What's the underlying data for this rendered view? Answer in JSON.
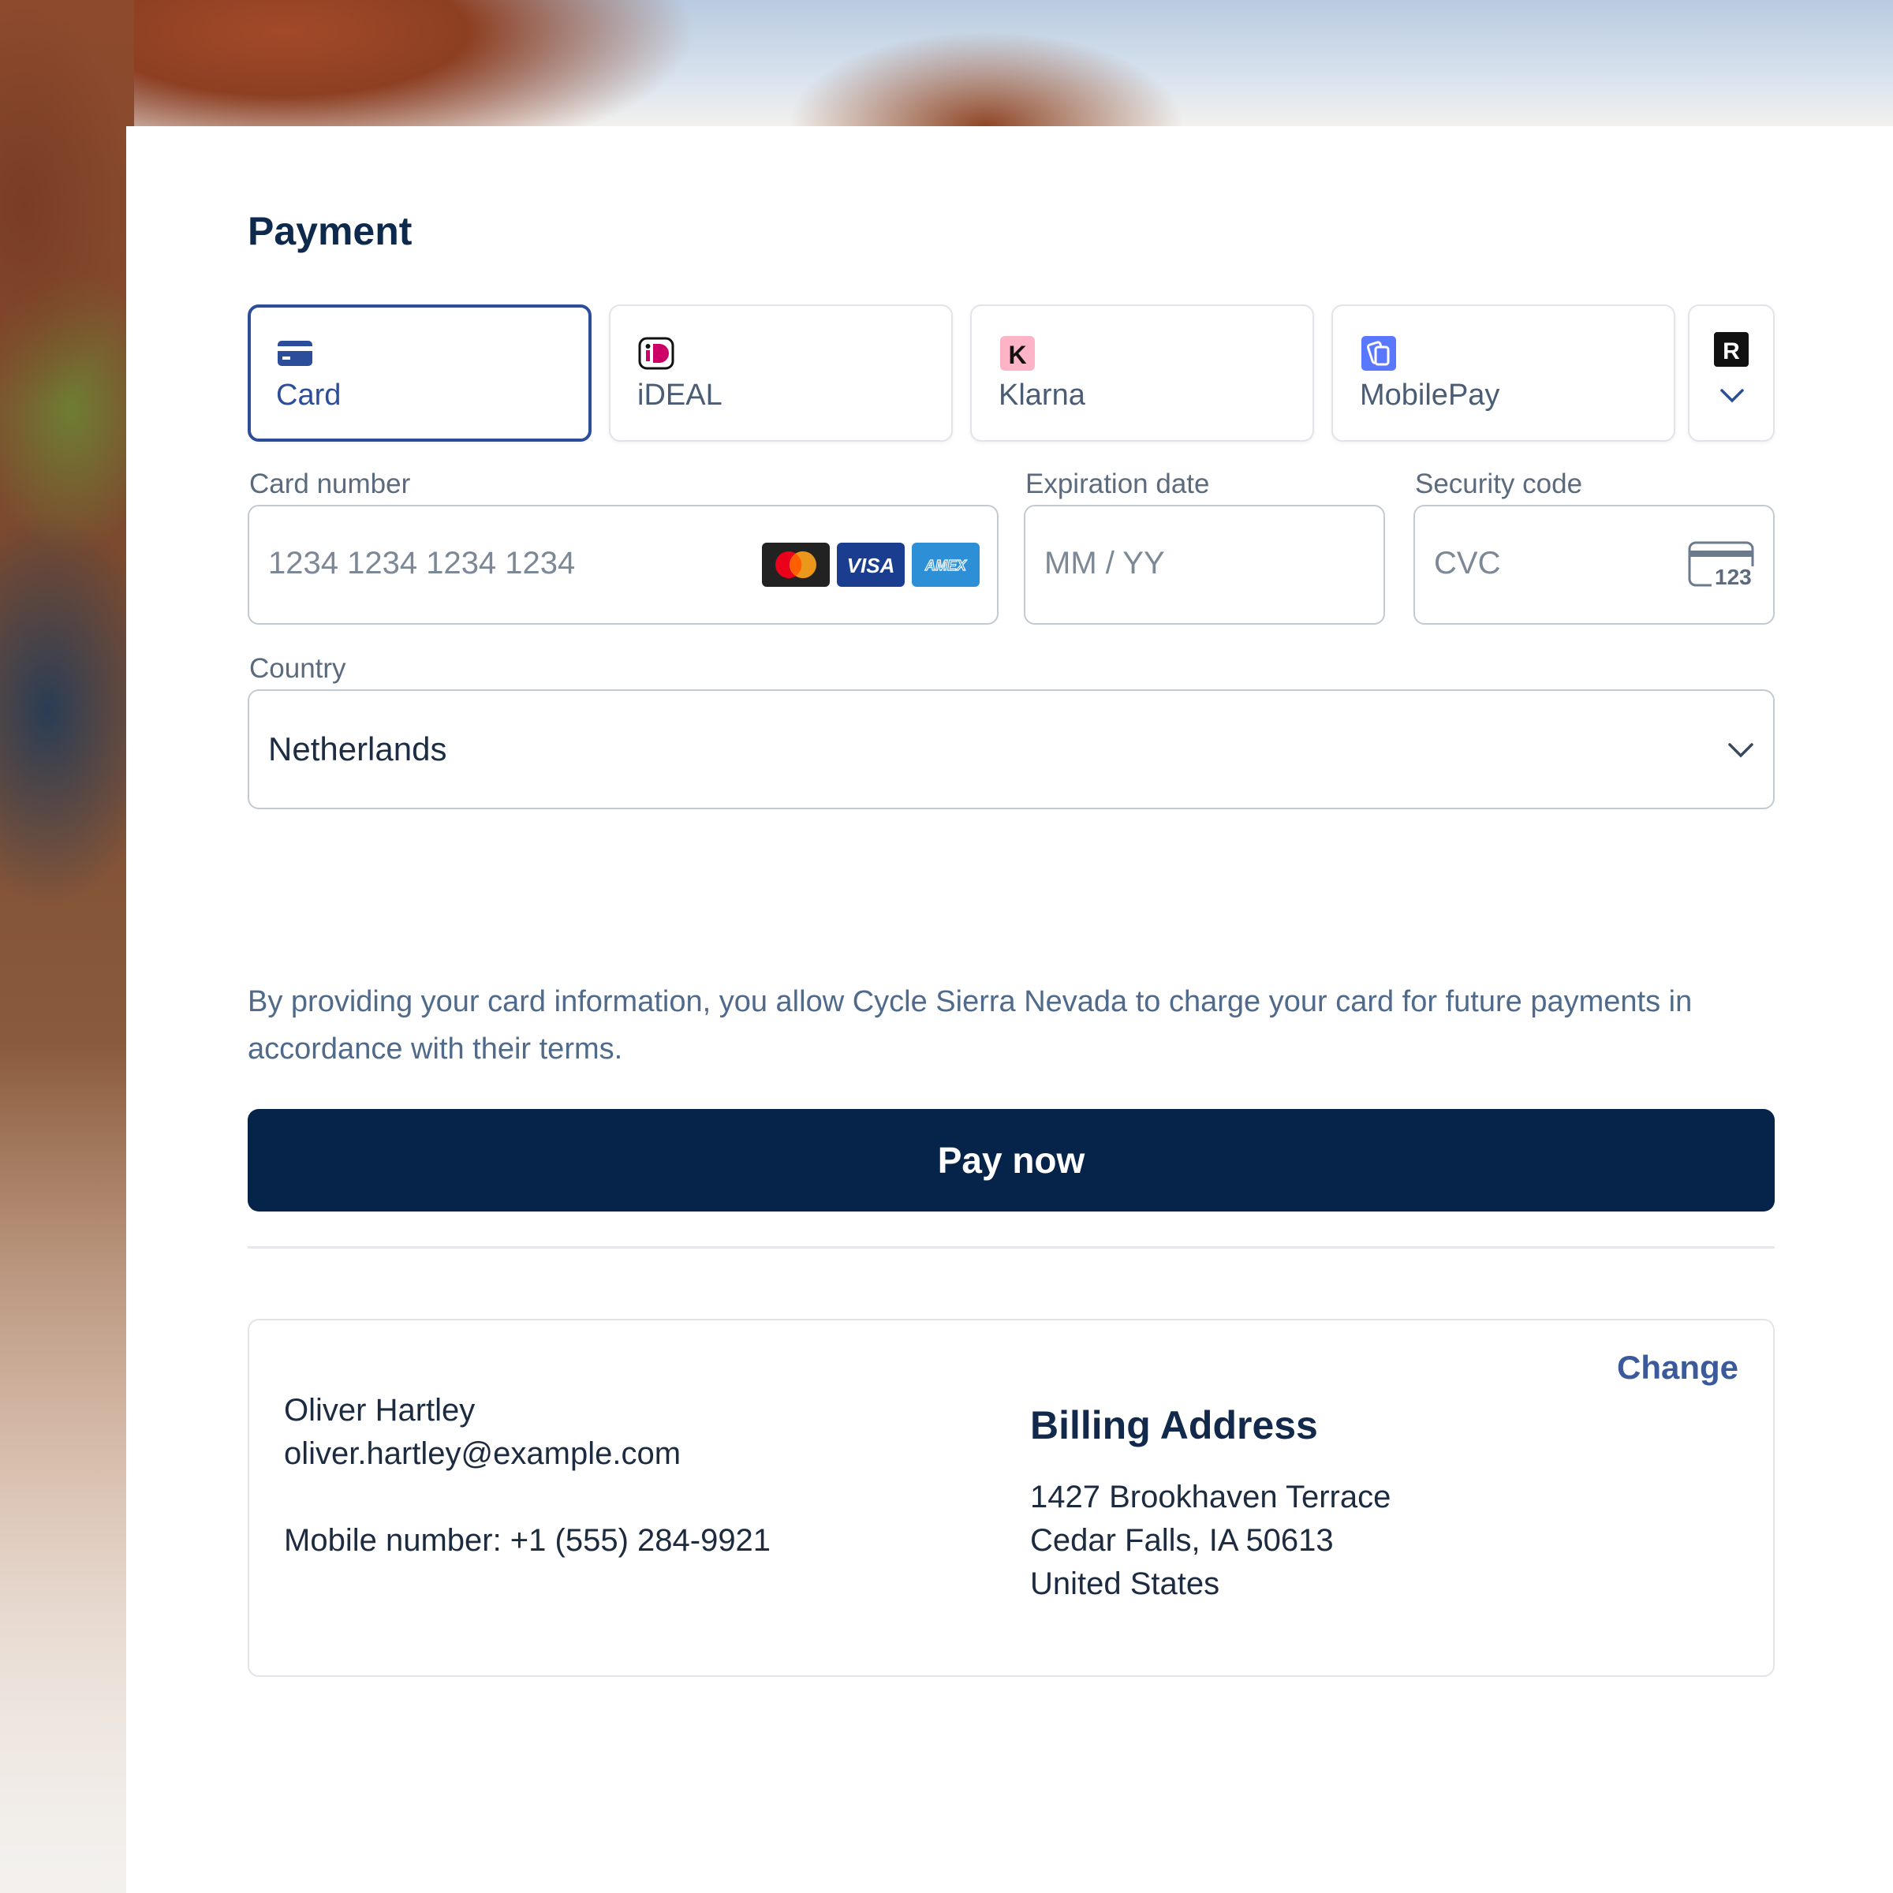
{
  "title": "Payment",
  "methods": [
    {
      "label": "Card",
      "icon": "card-icon",
      "active": true
    },
    {
      "label": "iDEAL",
      "icon": "ideal-icon",
      "active": false
    },
    {
      "label": "Klarna",
      "icon": "klarna-icon",
      "active": false
    },
    {
      "label": "MobilePay",
      "icon": "mobilepay-icon",
      "active": false
    }
  ],
  "more_method_icon": "revolut-icon",
  "card_number": {
    "label": "Card number",
    "placeholder": "1234 1234 1234 1234",
    "brands": [
      "mastercard",
      "visa",
      "amex"
    ]
  },
  "expiry": {
    "label": "Expiration date",
    "placeholder": "MM / YY"
  },
  "cvc": {
    "label": "Security code",
    "placeholder": "CVC",
    "icon_text": "123"
  },
  "country": {
    "label": "Country",
    "value": "Netherlands"
  },
  "notice": "By providing your card information, you allow Cycle Sierra Nevada to charge your card for future payments in accordance with their terms.",
  "pay_button": "Pay now",
  "summary": {
    "name": "Oliver Hartley",
    "email": "oliver.hartley@example.com",
    "mobile": "Mobile number: +1 (555) 284-9921",
    "change": "Change",
    "billing_title": "Billing Address",
    "address_line1": "1427 Brookhaven Terrace",
    "address_line2": "Cedar Falls, IA 50613",
    "address_line3": "United States"
  },
  "colors": {
    "primary": "#06234a",
    "accent": "#2c4d9a",
    "klarna": "#ffb3c7",
    "mobilepay": "#5a78ff"
  }
}
